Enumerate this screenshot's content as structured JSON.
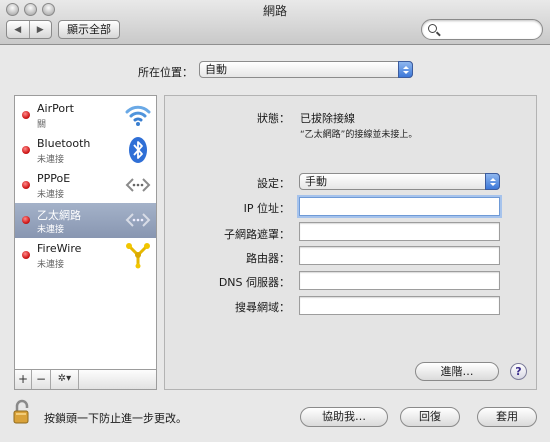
{
  "window": {
    "title": "網路"
  },
  "toolbar": {
    "back_glyph": "◀",
    "forward_glyph": "▶",
    "show_all_label": "顯示全部",
    "search_placeholder": ""
  },
  "location": {
    "label": "所在位置：",
    "value": "自動"
  },
  "sidebar": {
    "items": [
      {
        "name": "AirPort",
        "status": "關",
        "icon": "wifi-icon",
        "status_color": "#d11a1a",
        "selected": false
      },
      {
        "name": "Bluetooth",
        "status": "未連接",
        "icon": "bluetooth-icon",
        "status_color": "#d11a1a",
        "selected": false
      },
      {
        "name": "PPPoE",
        "status": "未連接",
        "icon": "pppoe-arrows-icon",
        "status_color": "#d11a1a",
        "selected": false
      },
      {
        "name": "乙太網路",
        "status": "未連接",
        "icon": "ethernet-arrows-icon",
        "status_color": "#d11a1a",
        "selected": true
      },
      {
        "name": "FireWire",
        "status": "未連接",
        "icon": "firewire-icon",
        "status_color": "#d11a1a",
        "selected": false
      }
    ],
    "add_label": "+",
    "remove_label": "−",
    "action_label": "✲▾"
  },
  "detail": {
    "status_label": "狀態：",
    "status_value": "已拔除接線",
    "status_description": "“乙太網路”的接線並未接上。",
    "configure_label": "設定：",
    "configure_value": "手動",
    "ip_label": "IP 位址：",
    "ip_value": "",
    "subnet_label": "子網路遮罩：",
    "subnet_value": "",
    "router_label": "路由器：",
    "router_value": "",
    "dns_label": "DNS 伺服器：",
    "dns_value": "",
    "search_domains_label": "搜尋網域：",
    "search_domains_value": "",
    "advanced_label": "進階…",
    "help_label": "?"
  },
  "footer": {
    "lock_text": "按鎖頭一下防止進一步更改。",
    "assist_label": "協助我…",
    "revert_label": "回復",
    "apply_label": "套用"
  },
  "colors": {
    "accent": "#3d78d8",
    "selection": "#8896b1",
    "status_off": "#d11a1a"
  }
}
